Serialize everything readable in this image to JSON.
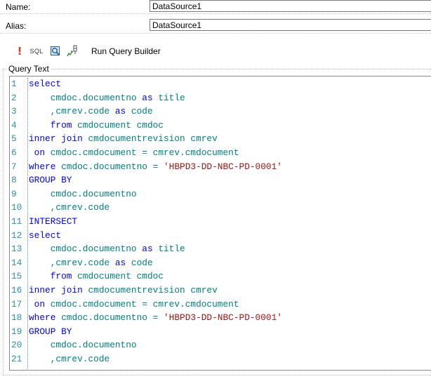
{
  "form": {
    "name_label": "Name:",
    "name_value": "DataSource1",
    "alias_label": "Alias:",
    "alias_value": "DataSource1"
  },
  "toolbar": {
    "icons": [
      "run-query-icon",
      "sql-icon",
      "query-check-icon",
      "parameters-icon"
    ],
    "excl_symbol": "!",
    "sql_label": "SQL",
    "run_query_builder_label": "Run Query Builder"
  },
  "query_text": {
    "legend": "Query Text",
    "lines": [
      {
        "n": "1",
        "tokens": [
          {
            "t": "select",
            "c": "kw"
          }
        ]
      },
      {
        "n": "2",
        "tokens": [
          {
            "t": "    cmdoc.documentno ",
            "c": "id"
          },
          {
            "t": "as",
            "c": "kw"
          },
          {
            "t": " title",
            "c": "id"
          }
        ]
      },
      {
        "n": "3",
        "tokens": [
          {
            "t": "    ,cmrev.code ",
            "c": "id"
          },
          {
            "t": "as",
            "c": "kw"
          },
          {
            "t": " code",
            "c": "id"
          }
        ]
      },
      {
        "n": "4",
        "tokens": [
          {
            "t": "    ",
            "c": "id"
          },
          {
            "t": "from",
            "c": "kw"
          },
          {
            "t": " cmdocument cmdoc",
            "c": "id"
          }
        ]
      },
      {
        "n": "5",
        "tokens": [
          {
            "t": "inner join",
            "c": "kw"
          },
          {
            "t": " cmdocumentrevision cmrev",
            "c": "id"
          }
        ]
      },
      {
        "n": "6",
        "tokens": [
          {
            "t": " on",
            "c": "kw"
          },
          {
            "t": " cmdoc.cmdocument = cmrev.cmdocument",
            "c": "id"
          }
        ]
      },
      {
        "n": "7",
        "tokens": [
          {
            "t": "where",
            "c": "kw"
          },
          {
            "t": " cmdoc.documentno = ",
            "c": "id"
          },
          {
            "t": "'HBPD3-DD-NBC-PD-0001'",
            "c": "str"
          }
        ]
      },
      {
        "n": "8",
        "tokens": [
          {
            "t": "GROUP BY",
            "c": "kw"
          }
        ]
      },
      {
        "n": "9",
        "tokens": [
          {
            "t": "    cmdoc.documentno",
            "c": "id"
          }
        ]
      },
      {
        "n": "10",
        "tokens": [
          {
            "t": "    ,cmrev.code",
            "c": "id"
          }
        ]
      },
      {
        "n": "11",
        "tokens": [
          {
            "t": "INTERSECT",
            "c": "kw"
          }
        ]
      },
      {
        "n": "12",
        "tokens": [
          {
            "t": "select",
            "c": "kw"
          }
        ]
      },
      {
        "n": "13",
        "tokens": [
          {
            "t": "    cmdoc.documentno ",
            "c": "id"
          },
          {
            "t": "as",
            "c": "kw"
          },
          {
            "t": " title",
            "c": "id"
          }
        ]
      },
      {
        "n": "14",
        "tokens": [
          {
            "t": "    ,cmrev.code ",
            "c": "id"
          },
          {
            "t": "as",
            "c": "kw"
          },
          {
            "t": " code",
            "c": "id"
          }
        ]
      },
      {
        "n": "15",
        "tokens": [
          {
            "t": "    ",
            "c": "id"
          },
          {
            "t": "from",
            "c": "kw"
          },
          {
            "t": " cmdocument cmdoc",
            "c": "id"
          }
        ]
      },
      {
        "n": "16",
        "tokens": [
          {
            "t": "inner join",
            "c": "kw"
          },
          {
            "t": " cmdocumentrevision cmrev",
            "c": "id"
          }
        ]
      },
      {
        "n": "17",
        "tokens": [
          {
            "t": " on",
            "c": "kw"
          },
          {
            "t": " cmdoc.cmdocument = cmrev.cmdocument",
            "c": "id"
          }
        ]
      },
      {
        "n": "18",
        "tokens": [
          {
            "t": "where",
            "c": "kw"
          },
          {
            "t": " cmdoc.documentno = ",
            "c": "id"
          },
          {
            "t": "'HBPD3-DD-NBC-PD-0001'",
            "c": "str"
          }
        ]
      },
      {
        "n": "19",
        "tokens": [
          {
            "t": "GROUP BY",
            "c": "kw"
          }
        ]
      },
      {
        "n": "20",
        "tokens": [
          {
            "t": "    cmdoc.documentno",
            "c": "id"
          }
        ]
      },
      {
        "n": "21",
        "tokens": [
          {
            "t": "    ,cmrev.code",
            "c": "id"
          }
        ]
      }
    ]
  },
  "colors": {
    "keyword": "#0000ff",
    "identifier": "#008080",
    "string": "#a31515",
    "line_number": "#2b91af",
    "run_icon": "#e23b16"
  }
}
